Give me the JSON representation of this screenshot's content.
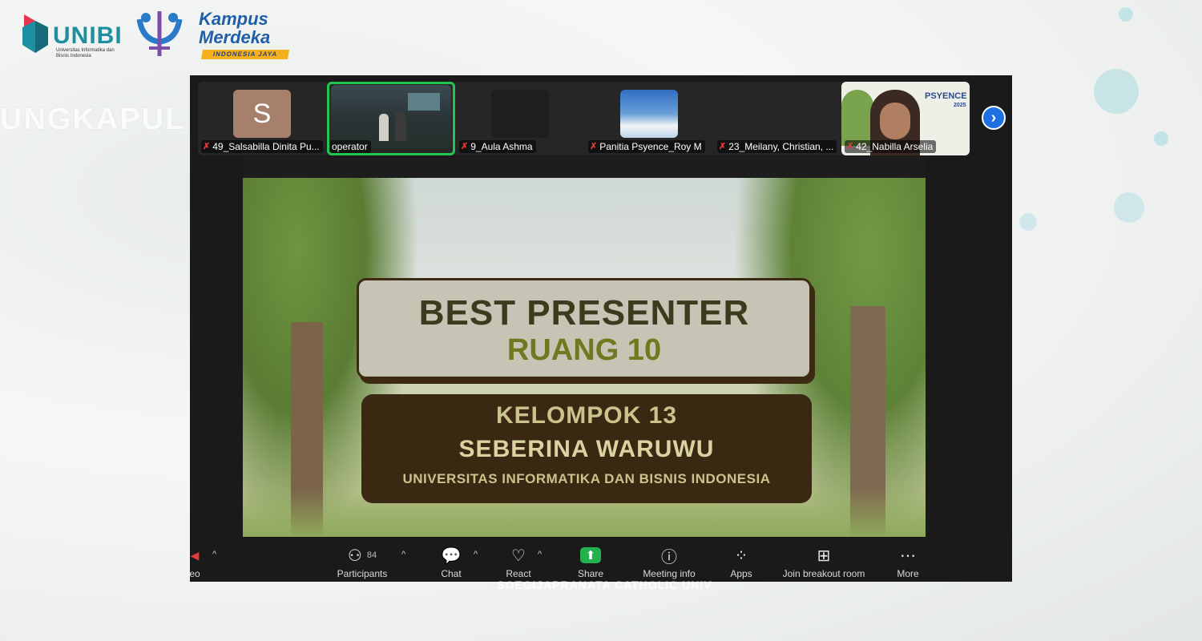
{
  "brand": {
    "unibi_name": "UNIBI",
    "unibi_sub": "Universitas Informatika dan Bisnis Indonesia",
    "km_name": "Kampus Merdeka",
    "km_tagline": "INDONESIA JAYA"
  },
  "participants_strip": [
    {
      "name": "49_Salsabilla Dinita Pu...",
      "muted": true
    },
    {
      "name": "operator",
      "muted": false
    },
    {
      "name": "9_Aula Ashma",
      "muted": true
    },
    {
      "name": "Panitia Psyence_Roy M",
      "muted": true
    },
    {
      "name": "23_Meilany, Christian, ...",
      "muted": true
    },
    {
      "name": "42_Nabilla Arselia",
      "muted": true
    }
  ],
  "avatar_initial": "S",
  "slide": {
    "title": "BEST PRESENTER",
    "room": "RUANG 10",
    "group": "KELOMPOK 13",
    "presenter": "SEBERINA WARUWU",
    "university": "UNIVERSITAS INFORMATIKA DAN BISNIS INDONESIA"
  },
  "psyence_label": "PSYENCE",
  "psyence_year": "2025",
  "toolbar": {
    "video_partial": "eo",
    "participants": "Participants",
    "participants_count": "84",
    "chat": "Chat",
    "react": "React",
    "share": "Share",
    "meeting_info": "Meeting info",
    "apps": "Apps",
    "breakout": "Join breakout room",
    "more": "More"
  },
  "under_text": "SOEGIJAPRANATA CATHOLIC UNIV",
  "colors": {
    "active_speaker": "#23c552",
    "share_green": "#22b14c",
    "next_blue": "#1e6fe0",
    "brand_teal": "#1c8fa0"
  }
}
